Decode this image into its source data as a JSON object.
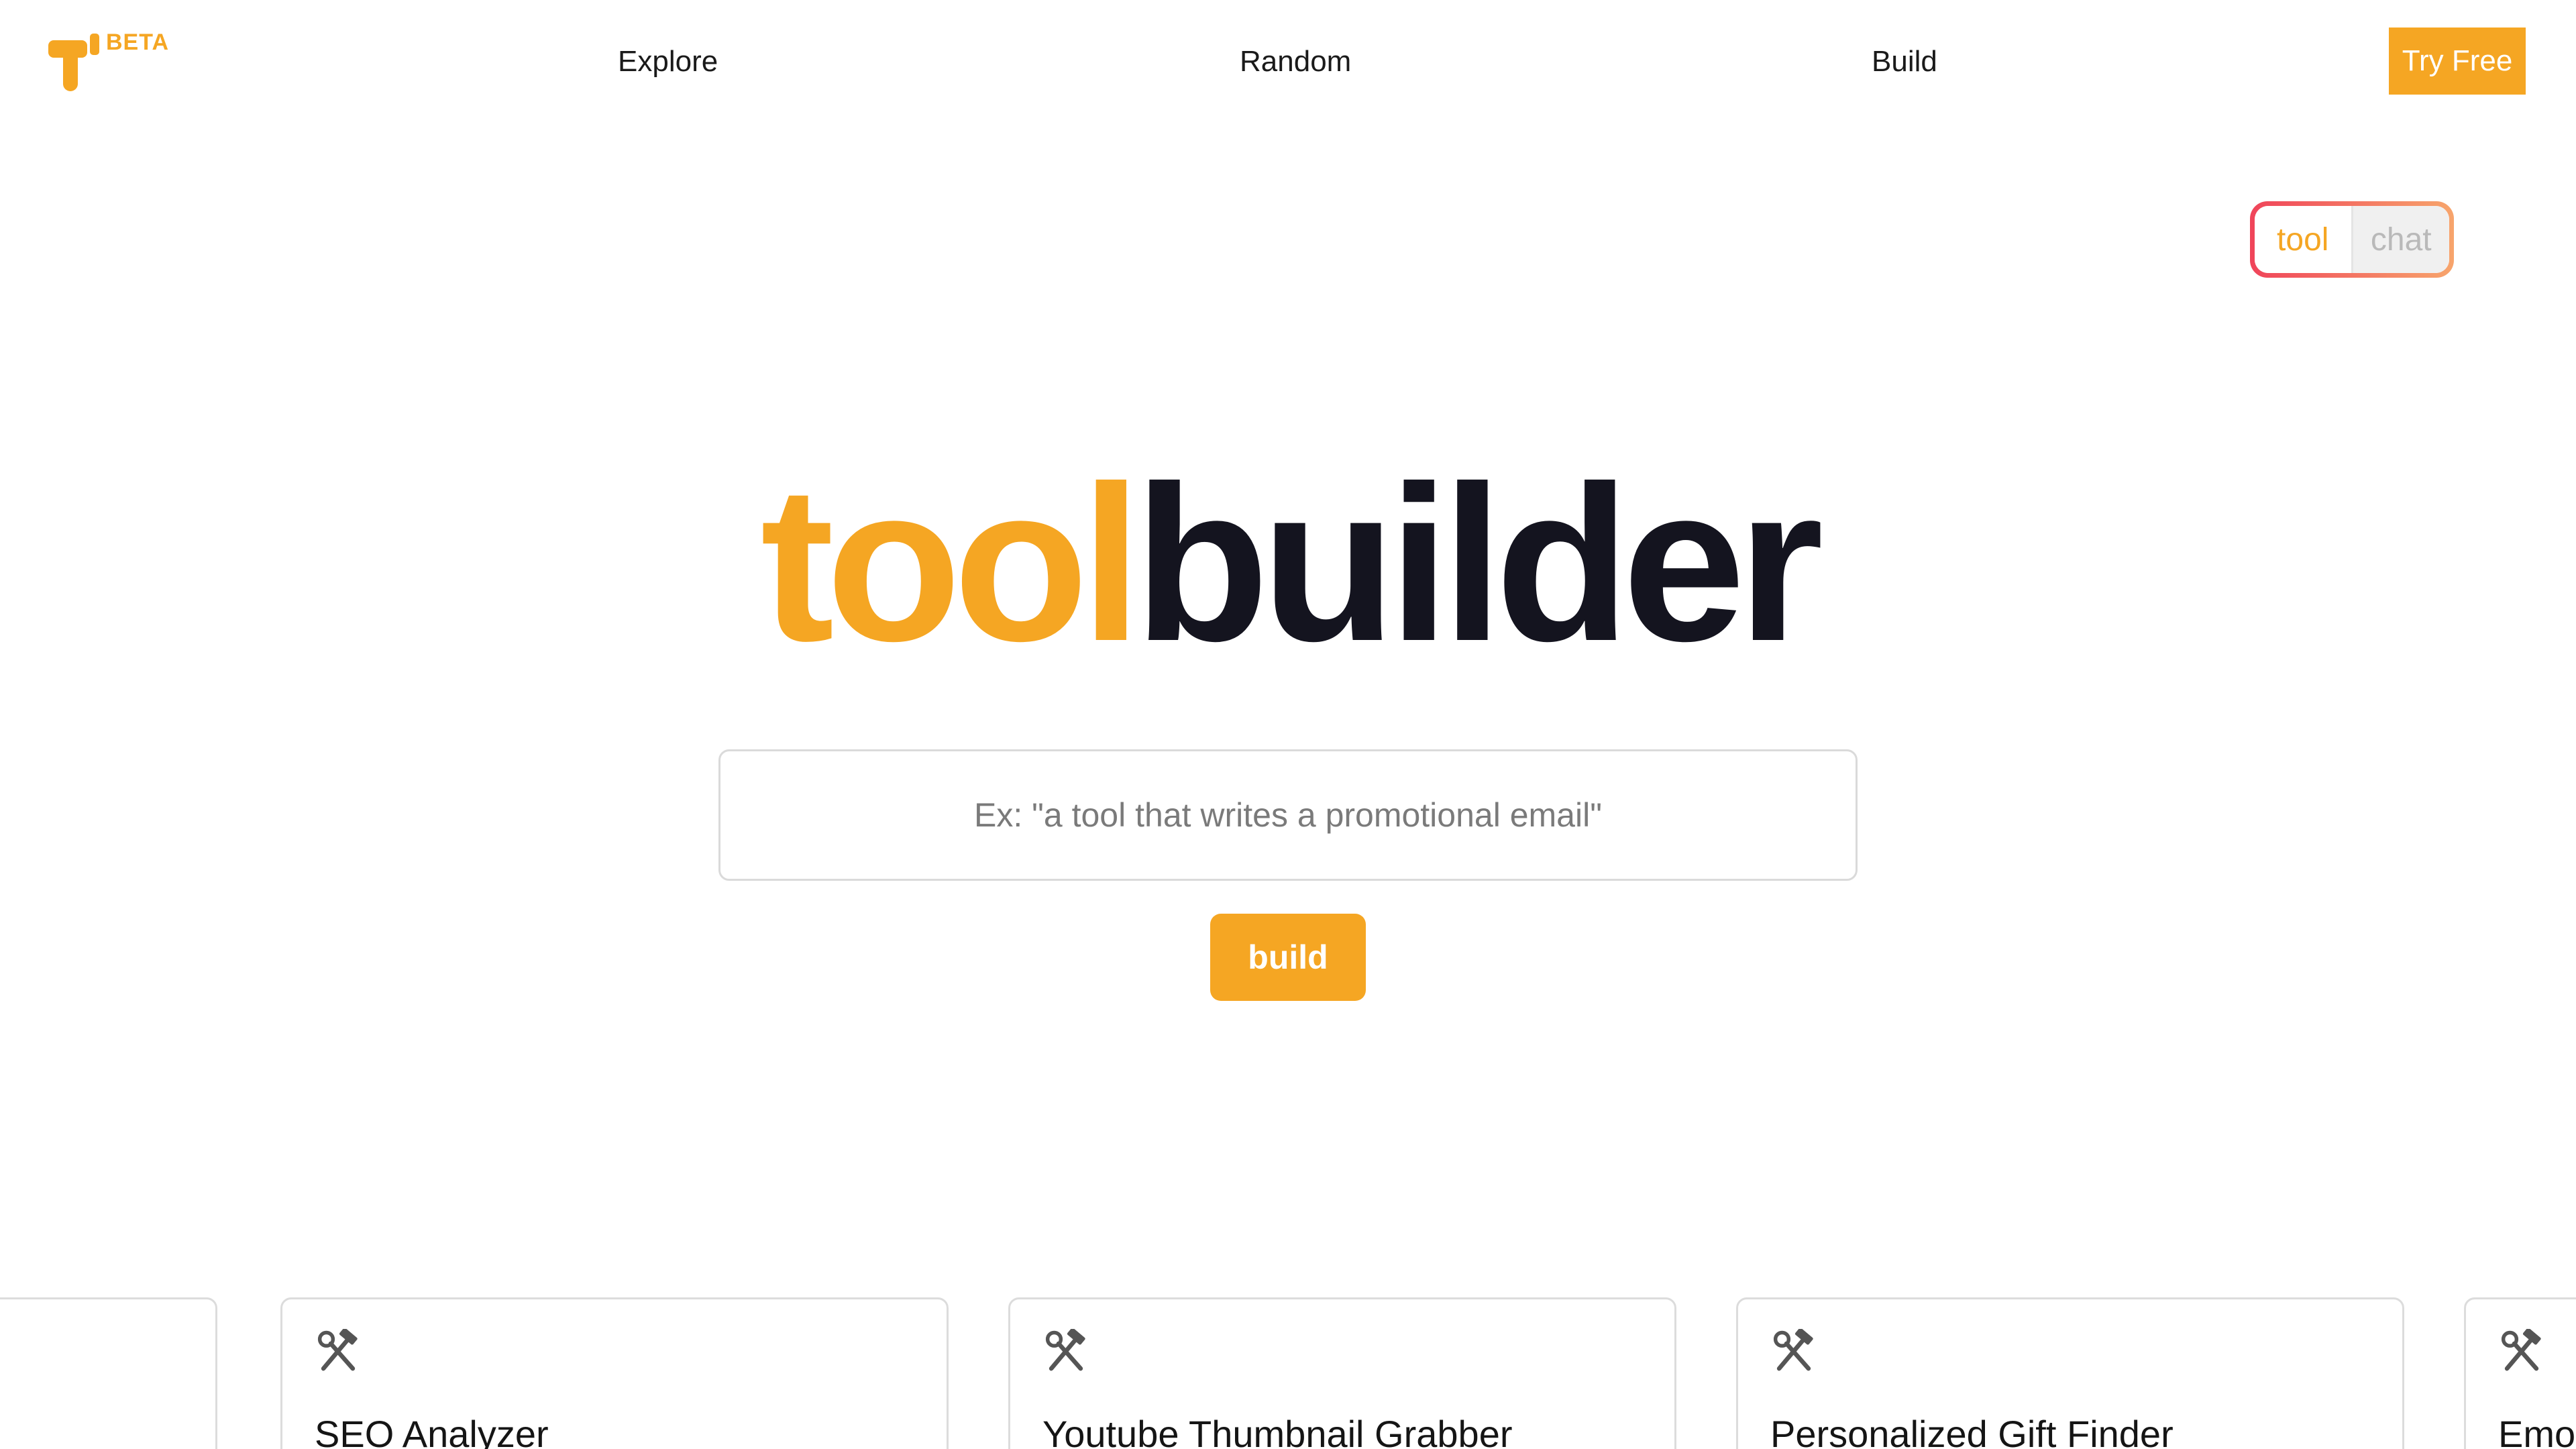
{
  "header": {
    "beta_label": "BETA",
    "nav": {
      "explore": "Explore",
      "random": "Random",
      "build": "Build"
    },
    "try_free_label": "Try Free"
  },
  "mode_toggle": {
    "tool_label": "tool",
    "chat_label": "chat",
    "selected": "tool"
  },
  "hero": {
    "brand_part1": "tool",
    "brand_part2": "builder",
    "input_placeholder": "Ex: \"a tool that writes a promotional email\"",
    "input_value": "",
    "build_label": "build"
  },
  "cards": [
    {
      "title": "",
      "icon": "hammer-wrench-icon"
    },
    {
      "title": "SEO Analyzer",
      "icon": "hammer-wrench-icon"
    },
    {
      "title": "Youtube Thumbnail Grabber",
      "icon": "hammer-wrench-icon"
    },
    {
      "title": "Personalized Gift Finder",
      "icon": "hammer-wrench-icon"
    },
    {
      "title": "Emo",
      "icon": "hammer-wrench-icon"
    }
  ],
  "colors": {
    "accent": "#f5a623",
    "dark_text": "#14141f",
    "toggle_gradient_start": "#f0445a",
    "toggle_gradient_end": "#f7a56c"
  }
}
